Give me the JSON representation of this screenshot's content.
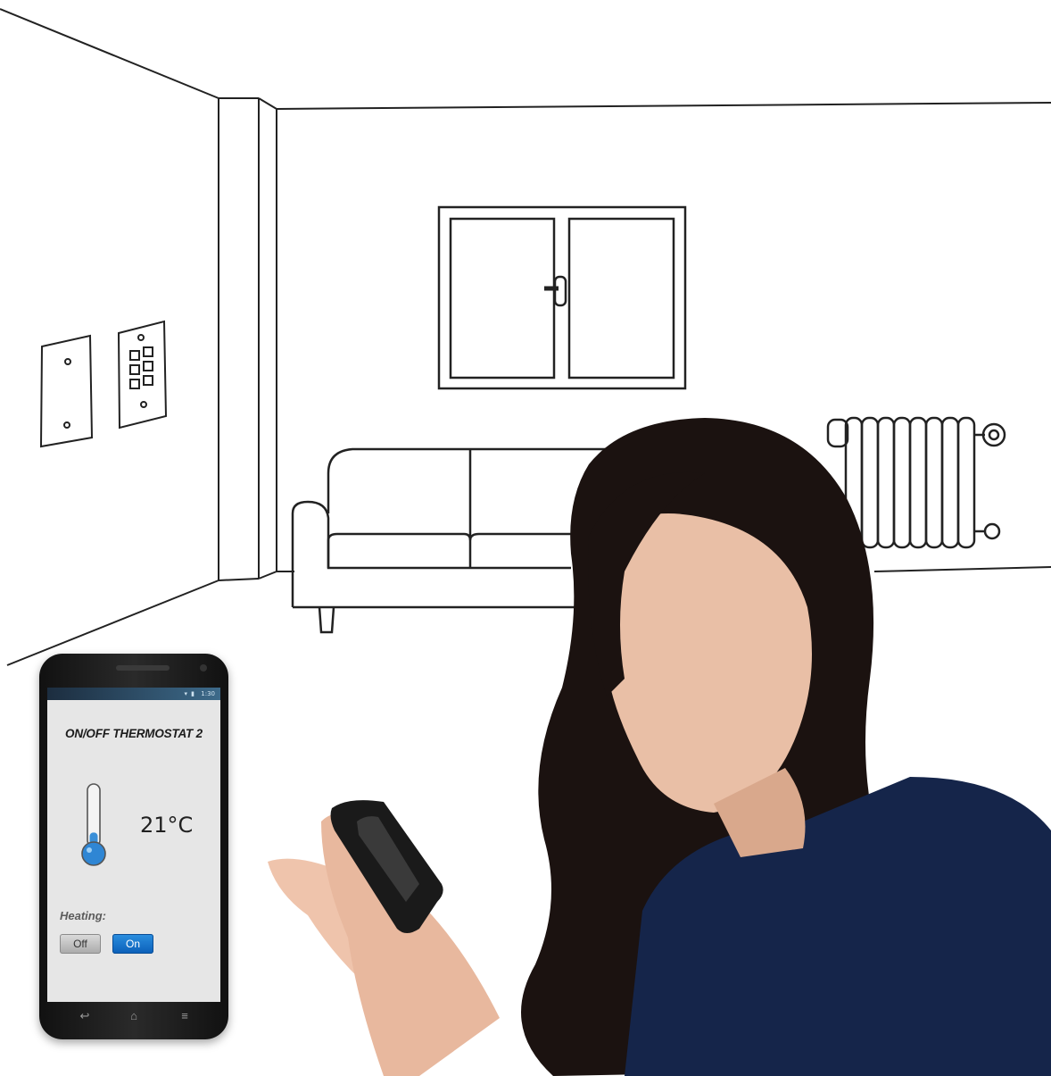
{
  "phone": {
    "status_time": "1:30",
    "status_icons": "▾ ▮",
    "app_title": "ON/OFF THERMOSTAT 2",
    "temperature": "21°C",
    "thermometer_level_pct": 30,
    "heating_label": "Heating:",
    "off_label": "Off",
    "on_label": "On",
    "heating_state": "On",
    "nav_icons": [
      "back-icon",
      "home-icon",
      "menu-icon"
    ],
    "nav_glyphs": [
      "↩",
      "⌂",
      "≡"
    ],
    "accent_color": "#1a72c8"
  }
}
